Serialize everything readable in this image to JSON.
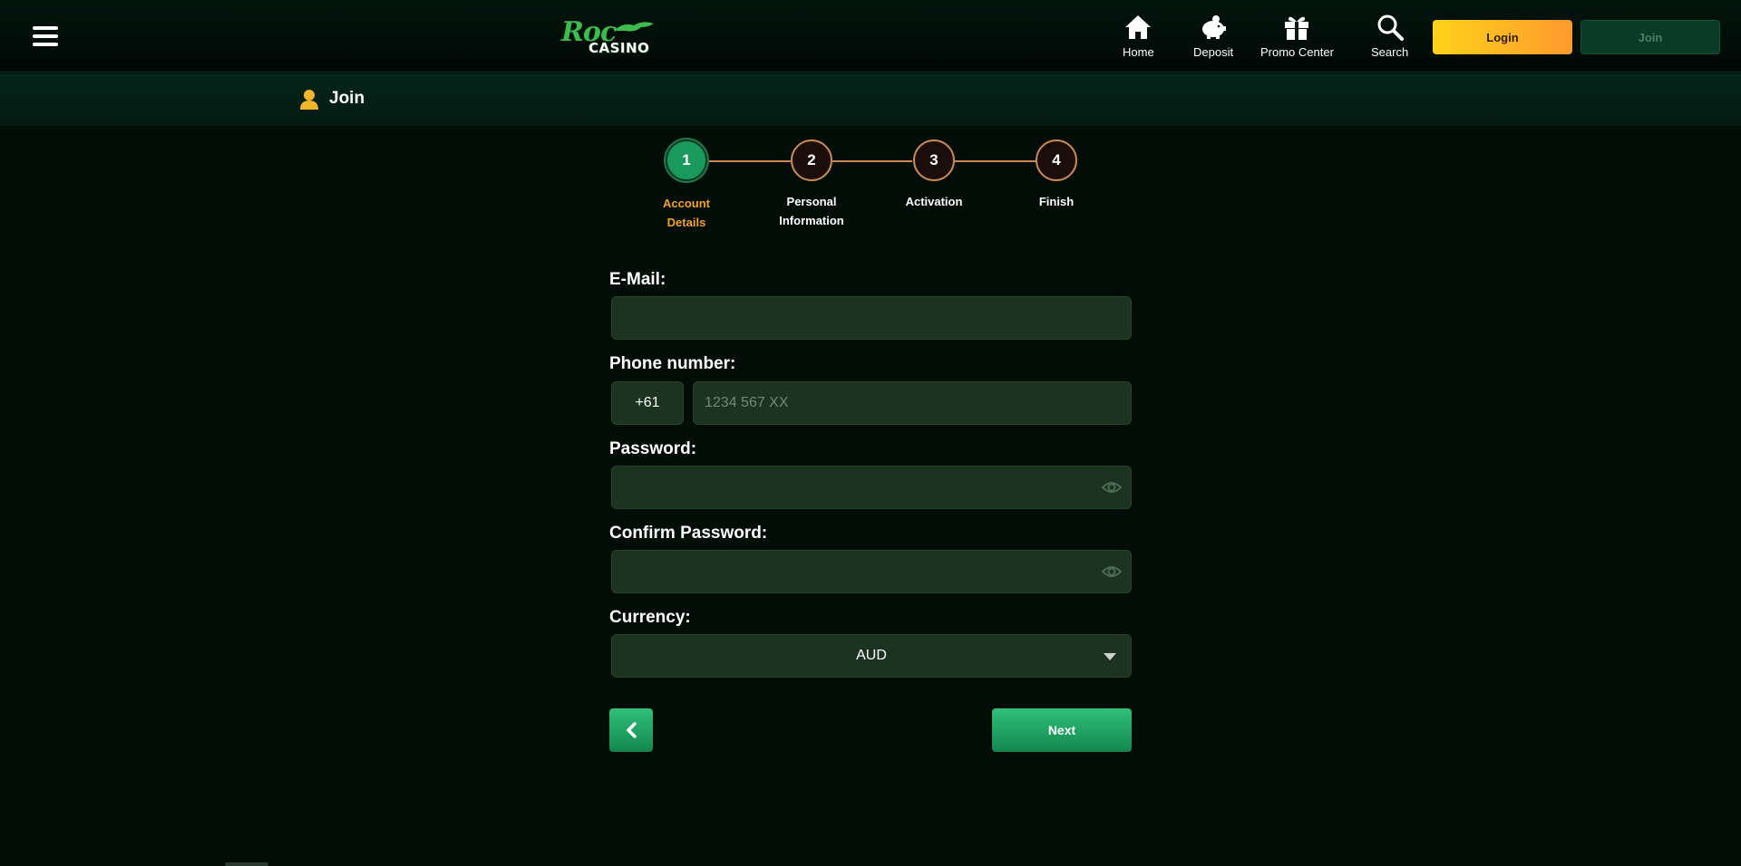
{
  "header": {
    "logo": {
      "top": "Roc",
      "bottom": "CASINO"
    },
    "nav": [
      {
        "label": "Home",
        "icon": "home-icon"
      },
      {
        "label": "Deposit",
        "icon": "piggy-bank-icon"
      },
      {
        "label": "Promo Center",
        "icon": "gift-icon"
      },
      {
        "label": "Search",
        "icon": "search-icon"
      }
    ],
    "login_label": "Login",
    "join_label": "Join"
  },
  "subheader": {
    "title": "Join",
    "icon": "user-icon"
  },
  "stepper": {
    "steps": [
      {
        "number": "1",
        "label_line1": "Account",
        "label_line2": "Details",
        "active": true
      },
      {
        "number": "2",
        "label_line1": "Personal",
        "label_line2": "Information",
        "active": false
      },
      {
        "number": "3",
        "label_line1": "Activation",
        "label_line2": "",
        "active": false
      },
      {
        "number": "4",
        "label_line1": "Finish",
        "label_line2": "",
        "active": false
      }
    ]
  },
  "form": {
    "email_label": "E-Mail:",
    "email_value": "",
    "phone_label": "Phone number:",
    "phone_prefix": "+61",
    "phone_placeholder": "1234 567 XX",
    "password_label": "Password:",
    "confirm_password_label": "Confirm Password:",
    "currency_label": "Currency:",
    "currency_value": "AUD",
    "next_label": "Next"
  },
  "colors": {
    "accent_green": "#1a9a5c",
    "accent_orange": "#f3a31f",
    "login_gradient_start": "#ffd21a",
    "login_gradient_end": "#ff9a2e",
    "field_bg": "#1b3320",
    "page_bg": "#020d08"
  }
}
